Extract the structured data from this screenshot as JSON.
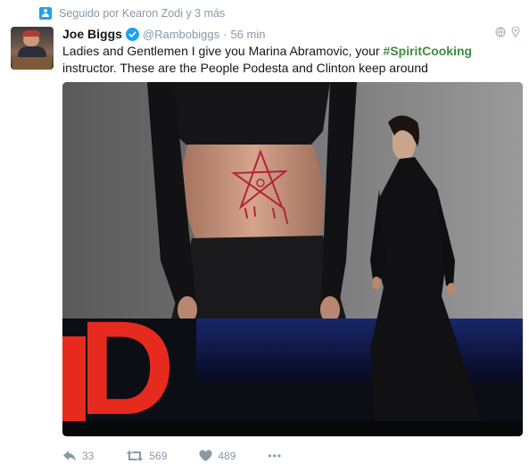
{
  "context": {
    "text": "Seguido por Kearon Zodi y 3 más",
    "icon": "person-icon"
  },
  "tweet": {
    "author_name": "Joe Biggs",
    "handle": "@Rambobiggs",
    "separator": "·",
    "time": "56 min",
    "text_part1": "Ladies and Gentlemen I give you Marina Abramovic, your ",
    "hashtag": "#SpiritCooking",
    "text_part2": " instructor. These are the People Podesta and Clinton keep around",
    "hashtag_color": "#3b8e3b"
  },
  "media": {
    "stage_letters": "D",
    "accent_color": "#e62b1e"
  },
  "actions": {
    "reply_count": "33",
    "retweet_count": "569",
    "like_count": "489",
    "more_label": "•••"
  },
  "colors": {
    "verified": "#1da1f2",
    "muted": "#8899a6"
  }
}
